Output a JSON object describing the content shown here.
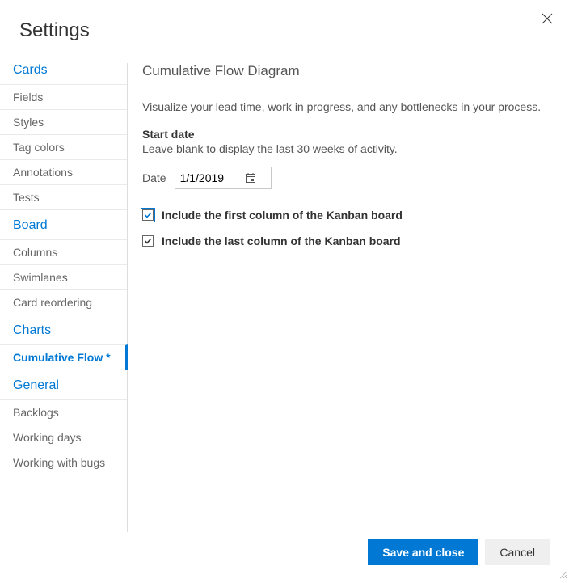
{
  "dialog": {
    "title": "Settings"
  },
  "sidebar": {
    "sections": [
      {
        "header": "Cards",
        "items": [
          {
            "label": "Fields"
          },
          {
            "label": "Styles"
          },
          {
            "label": "Tag colors"
          },
          {
            "label": "Annotations"
          },
          {
            "label": "Tests"
          }
        ]
      },
      {
        "header": "Board",
        "items": [
          {
            "label": "Columns"
          },
          {
            "label": "Swimlanes"
          },
          {
            "label": "Card reordering"
          }
        ]
      },
      {
        "header": "Charts",
        "items": [
          {
            "label": "Cumulative Flow *",
            "selected": true
          }
        ]
      },
      {
        "header": "General",
        "items": [
          {
            "label": "Backlogs"
          },
          {
            "label": "Working days"
          },
          {
            "label": "Working with bugs"
          }
        ]
      }
    ]
  },
  "content": {
    "title": "Cumulative Flow Diagram",
    "description": "Visualize your lead time, work in progress, and any bottlenecks in your process.",
    "start_date_label": "Start date",
    "start_date_hint": "Leave blank to display the last 30 weeks of activity.",
    "date_label": "Date",
    "date_value": "1/1/2019",
    "checkbox_first": "Include the first column of the Kanban board",
    "checkbox_last": "Include the last column of the Kanban board"
  },
  "footer": {
    "save": "Save and close",
    "cancel": "Cancel"
  }
}
